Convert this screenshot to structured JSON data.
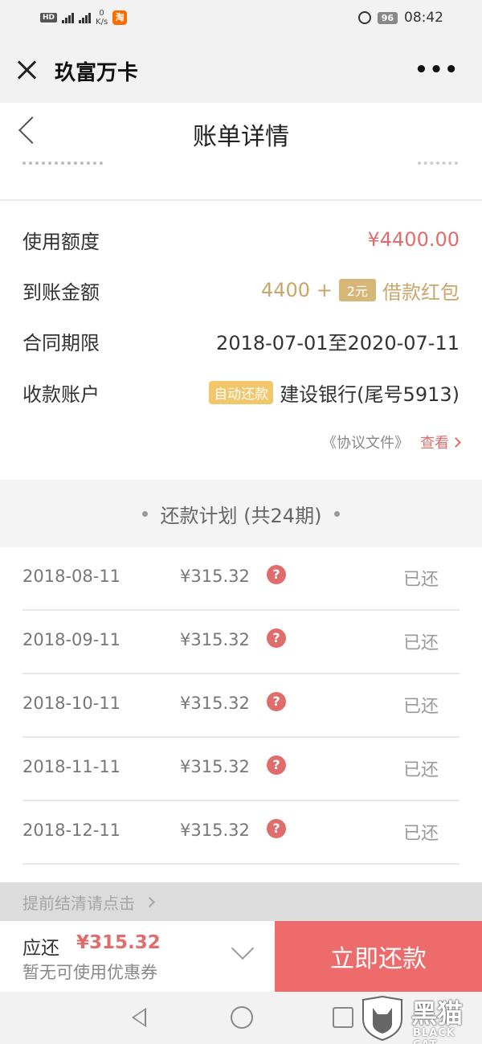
{
  "status_bar": {
    "hd_badge": "HD",
    "net_speed_value": "0",
    "net_speed_unit": "K/s",
    "app_icon": "淘",
    "battery": "96",
    "time": "08:42"
  },
  "wechat": {
    "title": "玖富万卡",
    "more": "•••"
  },
  "page": {
    "title": "账单详情"
  },
  "info": {
    "rows": [
      {
        "label": "使用额度",
        "value": "¥4400.00"
      },
      {
        "label": "到账金额",
        "amount_prefix": "4400 +",
        "tag": "2元",
        "suffix": "借款红包"
      },
      {
        "label": "合同期限",
        "value": "2018-07-01至2020-07-11"
      },
      {
        "label": "收款账户",
        "tag": "自动还款",
        "value": "建设银行(尾号5913)"
      }
    ],
    "doc_link": "《协议文件》",
    "view_link": "查看"
  },
  "plan": {
    "title": "还款计划 (共24期)",
    "rows": [
      {
        "date": "2018-08-11",
        "amount": "¥315.32",
        "status": "已还"
      },
      {
        "date": "2018-09-11",
        "amount": "¥315.32",
        "status": "已还"
      },
      {
        "date": "2018-10-11",
        "amount": "¥315.32",
        "status": "已还"
      },
      {
        "date": "2018-11-11",
        "amount": "¥315.32",
        "status": "已还"
      },
      {
        "date": "2018-12-11",
        "amount": "¥315.32",
        "status": "已还"
      }
    ]
  },
  "early_settle": "提前结清请点击",
  "bottom": {
    "due_label": "应还",
    "due_amount": "¥315.32",
    "coupon_text": "暂无可使用优惠券",
    "pay_button": "立即还款"
  },
  "watermark": {
    "text": "黑猫",
    "sub": "BLACK CAT"
  },
  "colors": {
    "accent_red": "#ee6b6b",
    "gold": "#c9a66b",
    "tag_yellow": "#f2c66b"
  }
}
